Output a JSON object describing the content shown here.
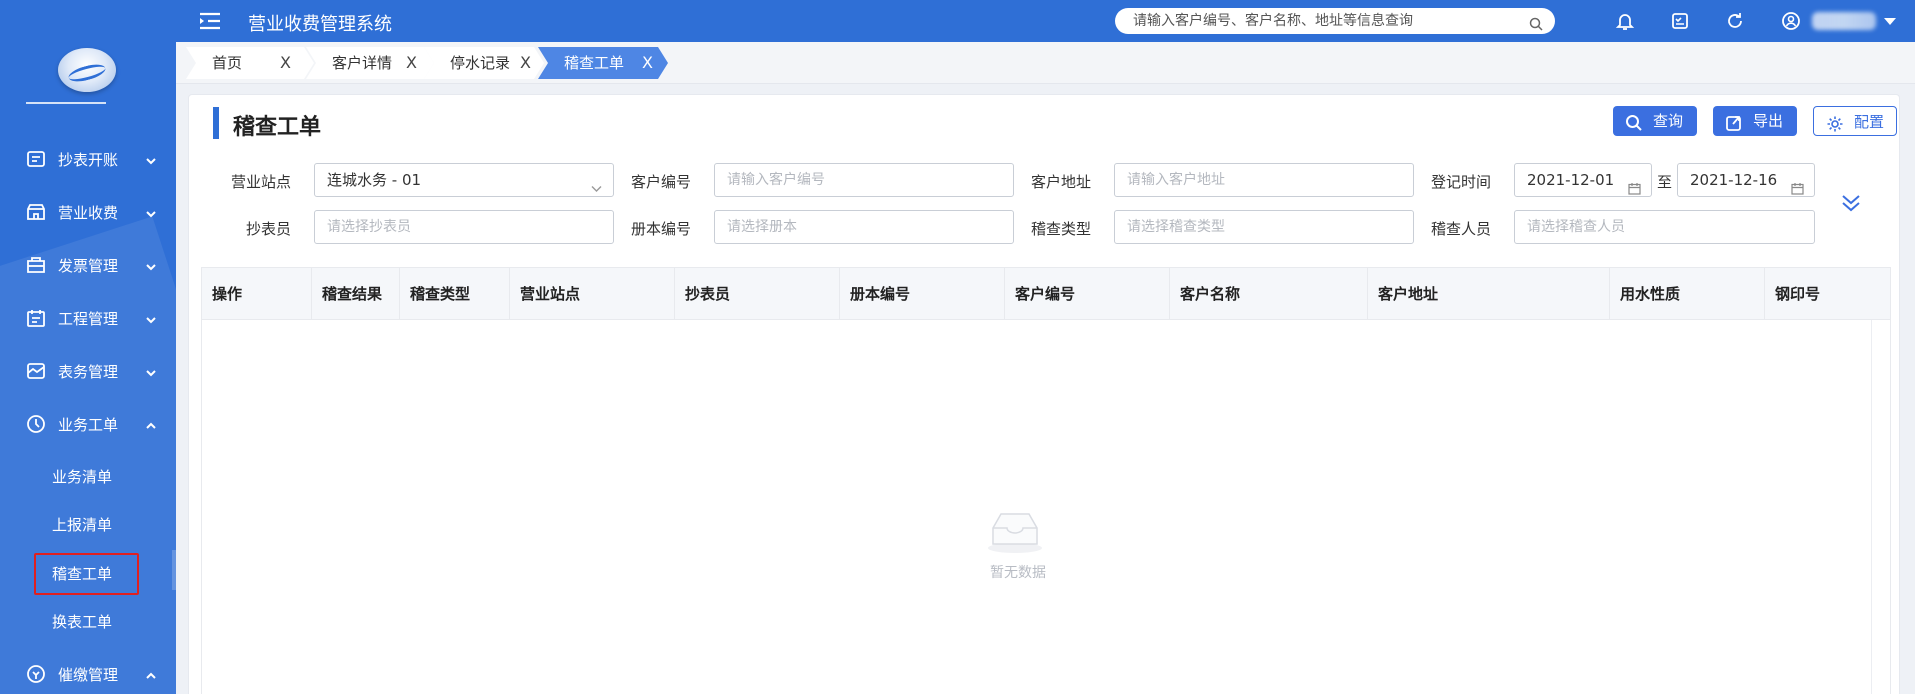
{
  "app": {
    "title": "营业收费管理系统"
  },
  "search": {
    "placeholder": "请输入客户编号、客户名称、地址等信息查询"
  },
  "sidebar": {
    "items": [
      {
        "label": "抄表开账",
        "icon": "meter-icon",
        "expanded": false
      },
      {
        "label": "营业收费",
        "icon": "store-icon",
        "expanded": false
      },
      {
        "label": "发票管理",
        "icon": "invoice-icon",
        "expanded": false
      },
      {
        "label": "工程管理",
        "icon": "project-icon",
        "expanded": false
      },
      {
        "label": "表务管理",
        "icon": "gauge-icon",
        "expanded": false
      },
      {
        "label": "业务工单",
        "icon": "workorder-icon",
        "expanded": true
      },
      {
        "label": "催缴管理",
        "icon": "dunning-icon",
        "expanded": true
      }
    ],
    "subitems": [
      "业务清单",
      "上报清单",
      "稽查工单",
      "换表工单"
    ],
    "active_subitem": "稽查工单"
  },
  "tabs": [
    {
      "label": "首页",
      "close": "X"
    },
    {
      "label": "客户详情",
      "close": "X"
    },
    {
      "label": "停水记录",
      "close": "X"
    },
    {
      "label": "稽查工单",
      "close": "X",
      "active": true
    }
  ],
  "page": {
    "title": "稽查工单"
  },
  "toolbar": {
    "query_label": "查询",
    "export_label": "导出",
    "config_label": "配置"
  },
  "filters": {
    "station": {
      "label": "营业站点",
      "value": "连城水务 - 01"
    },
    "customer_no": {
      "label": "客户编号",
      "placeholder": "请输入客户编号"
    },
    "address": {
      "label": "客户地址",
      "placeholder": "请输入客户地址"
    },
    "reg_time": {
      "label": "登记时间",
      "from": "2021-12-01",
      "to_word": "至",
      "to": "2021-12-16"
    },
    "reader": {
      "label": "抄表员",
      "placeholder": "请选择抄表员"
    },
    "book_no": {
      "label": "册本编号",
      "placeholder": "请选择册本"
    },
    "check_type": {
      "label": "稽查类型",
      "placeholder": "请选择稽查类型"
    },
    "inspector": {
      "label": "稽查人员",
      "placeholder": "请选择稽查人员"
    }
  },
  "table": {
    "columns": [
      "操作",
      "稽查结果",
      "稽查类型",
      "营业站点",
      "抄表员",
      "册本编号",
      "客户编号",
      "客户名称",
      "客户地址",
      "用水性质",
      "钢印号"
    ],
    "rows": [],
    "empty_text": "暂无数据"
  },
  "colors": {
    "brand": "#2f6fd6",
    "primary_button": "#3b6fe0",
    "highlight_box": "#e02020"
  }
}
